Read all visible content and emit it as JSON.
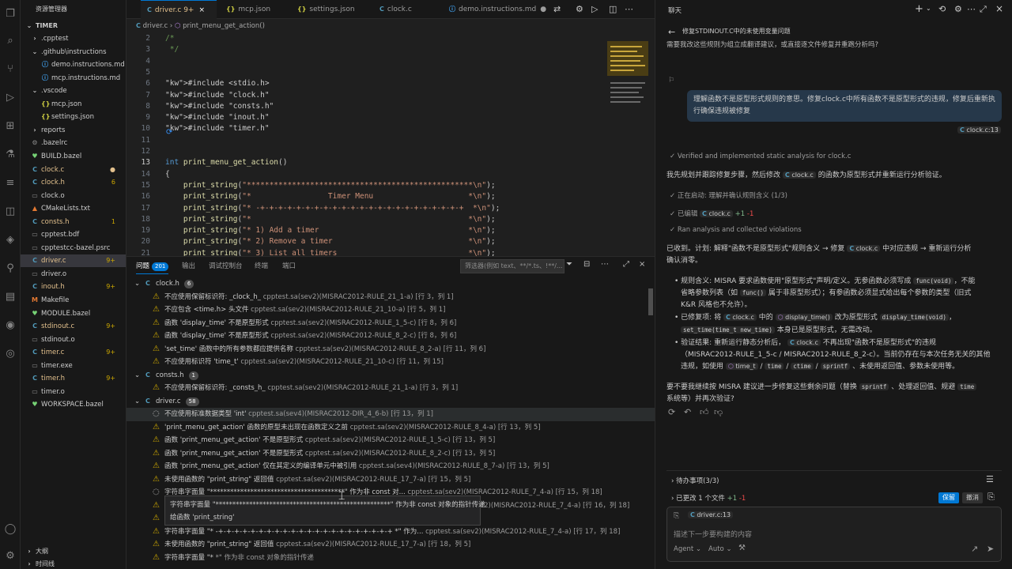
{
  "explorer": {
    "title": "资源管理器",
    "root": "TIMER",
    "items": [
      {
        "label": ".cpptest",
        "indent": 1,
        "icon": "chevron-right",
        "badge": ""
      },
      {
        "label": ".github\\instructions",
        "indent": 1,
        "icon": "chevron-down",
        "badge": ""
      },
      {
        "label": "demo.instructions.md",
        "indent": 2,
        "icon": "info",
        "badge": ""
      },
      {
        "label": "mcp.instructions.md",
        "indent": 2,
        "icon": "info",
        "badge": ""
      },
      {
        "label": ".vscode",
        "indent": 1,
        "icon": "chevron-down",
        "badge": ""
      },
      {
        "label": "mcp.json",
        "indent": 2,
        "icon": "json",
        "badge": ""
      },
      {
        "label": "settings.json",
        "indent": 2,
        "icon": "json",
        "badge": ""
      },
      {
        "label": "reports",
        "indent": 1,
        "icon": "chevron-right",
        "badge": ""
      },
      {
        "label": ".bazelrc",
        "indent": 1,
        "icon": "gear",
        "badge": ""
      },
      {
        "label": "BUILD.bazel",
        "indent": 1,
        "icon": "bazel",
        "badge": ""
      },
      {
        "label": "clock.c",
        "indent": 1,
        "icon": "c",
        "badge": "●"
      },
      {
        "label": "clock.h",
        "indent": 1,
        "icon": "c",
        "badge": "6"
      },
      {
        "label": "clock.o",
        "indent": 1,
        "icon": "file",
        "badge": ""
      },
      {
        "label": "CMakeLists.txt",
        "indent": 1,
        "icon": "cmake",
        "badge": ""
      },
      {
        "label": "consts.h",
        "indent": 1,
        "icon": "c",
        "badge": "1"
      },
      {
        "label": "cpptest.bdf",
        "indent": 1,
        "icon": "file",
        "badge": ""
      },
      {
        "label": "cpptestcc-bazel.psrc",
        "indent": 1,
        "icon": "file",
        "badge": ""
      },
      {
        "label": "driver.c",
        "indent": 1,
        "icon": "c",
        "badge": "9+"
      },
      {
        "label": "driver.o",
        "indent": 1,
        "icon": "file",
        "badge": ""
      },
      {
        "label": "inout.h",
        "indent": 1,
        "icon": "c",
        "badge": "9+"
      },
      {
        "label": "Makefile",
        "indent": 1,
        "icon": "make",
        "badge": ""
      },
      {
        "label": "MODULE.bazel",
        "indent": 1,
        "icon": "bazel",
        "badge": ""
      },
      {
        "label": "stdinout.c",
        "indent": 1,
        "icon": "c",
        "badge": "9+"
      },
      {
        "label": "stdinout.o",
        "indent": 1,
        "icon": "file",
        "badge": ""
      },
      {
        "label": "timer.c",
        "indent": 1,
        "icon": "c",
        "badge": "9+"
      },
      {
        "label": "timer.exe",
        "indent": 1,
        "icon": "file",
        "badge": ""
      },
      {
        "label": "timer.h",
        "indent": 1,
        "icon": "c",
        "badge": "9+"
      },
      {
        "label": "timer.o",
        "indent": 1,
        "icon": "file",
        "badge": ""
      },
      {
        "label": "WORKSPACE.bazel",
        "indent": 1,
        "icon": "bazel",
        "badge": ""
      }
    ],
    "outline": "大纲",
    "timeline": "时间线"
  },
  "tabs": [
    {
      "label": "driver.c 9+",
      "icon": "C",
      "active": true
    },
    {
      "label": "mcp.json",
      "icon": "{}",
      "active": false
    },
    {
      "label": "settings.json",
      "icon": "{}",
      "active": false
    },
    {
      "label": "clock.c",
      "icon": "C",
      "active": false
    },
    {
      "label": "demo.instructions.md",
      "icon": "i",
      "active": false
    }
  ],
  "breadcrumb": {
    "file": "driver.c",
    "symbol": "print_menu_get_action()"
  },
  "editor": {
    "lines": [
      {
        "n": "2",
        "t": "/*"
      },
      {
        "n": "3",
        "t": " */"
      },
      {
        "n": "4",
        "t": ""
      },
      {
        "n": "5",
        "t": ""
      },
      {
        "n": "6",
        "t": "#include <stdio.h>"
      },
      {
        "n": "7",
        "t": "#include \"clock.h\""
      },
      {
        "n": "8",
        "t": "#include \"consts.h\""
      },
      {
        "n": "9",
        "t": "#include \"inout.h\""
      },
      {
        "n": "10",
        "t": "#include \"timer.h\""
      },
      {
        "n": "11",
        "t": ""
      },
      {
        "n": "12",
        "t": ""
      },
      {
        "n": "13",
        "t": "int print_menu_get_action()"
      },
      {
        "n": "14",
        "t": "{"
      },
      {
        "n": "15",
        "t": "    print_string(\"**************************************************\\n\");"
      },
      {
        "n": "16",
        "t": "    print_string(\"*                 Timer Menu                     *\\n\");"
      },
      {
        "n": "17",
        "t": "    print_string(\"* -+-+-+-+-+-+-+-+-+-+-+-+-+-+-+-+-+-+-+-+-+-+-+  *\\n\");"
      },
      {
        "n": "18",
        "t": "    print_string(\"*                                                *\\n\");"
      },
      {
        "n": "19",
        "t": "    print_string(\"* 1) Add a timer                                 *\\n\");"
      },
      {
        "n": "20",
        "t": "    print_string(\"* 2) Remove a timer                              *\\n\");"
      },
      {
        "n": "21",
        "t": "    print_string(\"* 3) List all timers                             *\\n\");"
      },
      {
        "n": "22",
        "t": "    print_string(\"* 4) Show time                                   *\\n\");"
      }
    ],
    "current_line": "13"
  },
  "panel": {
    "tabs": [
      "问题",
      "输出",
      "调试控制台",
      "终端",
      "端口"
    ],
    "problem_count": "201",
    "filter_placeholder": "筛选器(例如 text、**/*.ts、!**/...",
    "groups": [
      {
        "file": "clock.h",
        "count": "6",
        "items": [
          {
            "sev": "warning",
            "msg": "不应使用保留标识符: _clock_h_",
            "src": "cpptest.sa(sev2)(MISRAC2012-RULE_21_1-a) [行 3，列 1]"
          },
          {
            "sev": "warning",
            "msg": "不应包含 <time.h> 头文件",
            "src": "cpptest.sa(sev2)(MISRAC2012-RULE_21_10-a) [行 5，列 1]"
          },
          {
            "sev": "warning",
            "msg": "函数 'display_time' 不是原型形式",
            "src": "cpptest.sa(sev2)(MISRAC2012-RULE_1_5-c) [行 8，列 6]"
          },
          {
            "sev": "warning",
            "msg": "函数 'display_time' 不是原型形式",
            "src": "cpptest.sa(sev2)(MISRAC2012-RULE_8_2-c) [行 8，列 6]"
          },
          {
            "sev": "warning",
            "msg": "'set_time' 函数中的所有参数都应提供名称",
            "src": "cpptest.sa(sev2)(MISRAC2012-RULE_8_2-a) [行 11，列 6]"
          },
          {
            "sev": "warning",
            "msg": "不应使用标识符 'time_t'",
            "src": "cpptest.sa(sev2)(MISRAC2012-RULE_21_10-c) [行 11，列 15]"
          }
        ]
      },
      {
        "file": "consts.h",
        "count": "1",
        "items": [
          {
            "sev": "warning",
            "msg": "不应使用保留标识符: _consts_h_",
            "src": "cpptest.sa(sev2)(MISRAC2012-RULE_21_1-a) [行 3，列 1]"
          }
        ]
      },
      {
        "file": "driver.c",
        "count": "58",
        "items": [
          {
            "sev": "info",
            "msg": "不应使用标准数据类型 'int'",
            "src": "cpptest.sa(sev4)(MISRAC2012-DIR_4_6-b) [行 13，列 1]"
          },
          {
            "sev": "warning",
            "msg": "'print_menu_get_action' 函数的原型未出现在函数定义之前",
            "src": "cpptest.sa(sev2)(MISRAC2012-RULE_8_4-a) [行 13，列 5]"
          },
          {
            "sev": "warning",
            "msg": "函数 'print_menu_get_action' 不是原型形式",
            "src": "cpptest.sa(sev2)(MISRAC2012-RULE_1_5-c) [行 13，列 5]"
          },
          {
            "sev": "warning",
            "msg": "函数 'print_menu_get_action' 不是原型形式",
            "src": "cpptest.sa(sev2)(MISRAC2012-RULE_8_2-c) [行 13，列 5]"
          },
          {
            "sev": "warning",
            "msg": "函数 'print_menu_get_action' 仅在其定义的编译单元中被引用",
            "src": "cpptest.sa(sev4)(MISRAC2012-RULE_8_7-a) [行 13，列 5]"
          },
          {
            "sev": "warning",
            "msg": "未使用函数的 \"print_string\" 返回值",
            "src": "cpptest.sa(sev2)(MISRAC2012-RULE_17_7-a) [行 15，列 5]"
          },
          {
            "sev": "info",
            "msg": "字符串字面量 \"****************************************\" 作为非 const 对...",
            "src": "cpptest.sa(sev2)(MISRAC2012-RULE_7_4-a) [行 15，列 18]"
          },
          {
            "sev": "warning",
            "msg": "",
            "src": "cpptest.sa(sev2)(MISRAC2012-RULE_7_4-a) [行 16，列 18]"
          },
          {
            "sev": "warning",
            "msg": "未使用函数的 \"print_string\" 返回值",
            "src": "cpptest.sa(sev2)(MISRAC2012-RULE_17_7-a) [行 17，列 5]"
          },
          {
            "sev": "warning",
            "msg": "字符串字面量 \"* -+-+-+-+-+-+-+-+-+-+-+-+-+-+-+-+-+-+-+-+-+-+ *\" 作为...",
            "src": "cpptest.sa(sev2)(MISRAC2012-RULE_7_4-a) [行 17，列 18]"
          },
          {
            "sev": "warning",
            "msg": "未使用函数的 \"print_string\" 返回值",
            "src": "cpptest.sa(sev2)(MISRAC2012-RULE_17_7-a) [行 18，列 5]"
          },
          {
            "sev": "warning",
            "msg": "字符串字面量 \"*",
            "src": "*\" 作为非 const 对象的指针传递"
          }
        ]
      }
    ],
    "hover": {
      "line1": "字符串字面量 \"****************************************************\" 作为非 const 对象的指针传递",
      "line2": "给函数 'print_string'"
    }
  },
  "chat": {
    "title": "聊天",
    "thread_title": "修复STDINOUT.C中的未使用变量问题",
    "top_cut_text": "需要我改这些规则为组立成翻译建议，或直接逐文件修复并重跑分析吗?",
    "user_message": "理解函数不是原型形式规则的意思。修复clock.c中所有函数不是原型形式的违规，修复后重新执行确保违规被修复",
    "user_ref": "clock.c:13",
    "step1": "Verified and implemented static analysis for clock.c",
    "plan_intro": "我先规划并跟踪修复步骤，然后修改",
    "plan_file": "clock.c",
    "plan_end": "的函数为原型形式并重新运行分析验证。",
    "step2": "正在启动: 理解并确认规则含义 (1/3)",
    "step3_label": "已编辑",
    "step3_file": "clock.c",
    "step3_add": "+1",
    "step3_del": "-1",
    "step4": "Ran analysis and collected violations",
    "summary_a": "已收到。计划: 解释\"函数不是原型形式\"规则含义 → 修复",
    "summary_file": "clock.c",
    "summary_b": "中对应违规 → 重新运行分析",
    "summary_c": "确认消零。",
    "b1_head": "规则含义: MISRA 要求函数使用\"原型形式\"声明/定义。无参函数必须写成",
    "b1_code1": "func(void)",
    "b1_mid": "，不能",
    "b1_line2a": "省略参数列表（如",
    "b1_code2": "func()",
    "b1_line2b": "属于非原型形式）；有参函数必须显式给出每个参数的类型（旧式",
    "b1_line3": "K&R 风格也不允许）。",
    "b2_a": "已修复项: 将",
    "b2_file": "clock.c",
    "b2_b": "中的",
    "b2_fn": "display_time()",
    "b2_c": "改为原型形式",
    "b2_code": "display_time(void)",
    "b2_code2": "set_time(time_t new_time)",
    "b2_d": "本身已是原型形式，无需改动。",
    "b3_a": "验证结果: 重新运行静态分析后，",
    "b3_file": "clock.c",
    "b3_b": "不再出现\"函数不是原型形式\"的违规",
    "b3_line2": "（MISRAC2012-RULE_1_5-c / MISRAC2012-RULE_8_2-c）。当前仍存在与本次任务无关的其他",
    "b3_line3a": "违规，如使用",
    "b3_fn": "time_t",
    "b3_code1": "time",
    "b3_code2": "ctime",
    "b3_code3": "sprintf",
    "b3_line3b": "、未使用返回值、参数未使用等。",
    "question_a": "要不要我继续按 MISRA 建议进一步修复这些剩余问题（替换",
    "question_code1": "sprintf",
    "question_b": "、处理返回值、规避",
    "question_code2": "time",
    "question_c": "系统等）并再次验证?",
    "todo": "待办事项(3/3)",
    "changed": "已更改 1 个文件",
    "changed_add": "+1",
    "changed_del": "-1",
    "keep": "保留",
    "undo": "撤消",
    "context_file": "driver.c:13",
    "input_placeholder": "描述下一步要构建的内容",
    "mode": "Agent",
    "model": "Auto"
  },
  "colors": {
    "accent": "#0078d4",
    "warning": "#cca700",
    "c_icon": "#519aba"
  }
}
